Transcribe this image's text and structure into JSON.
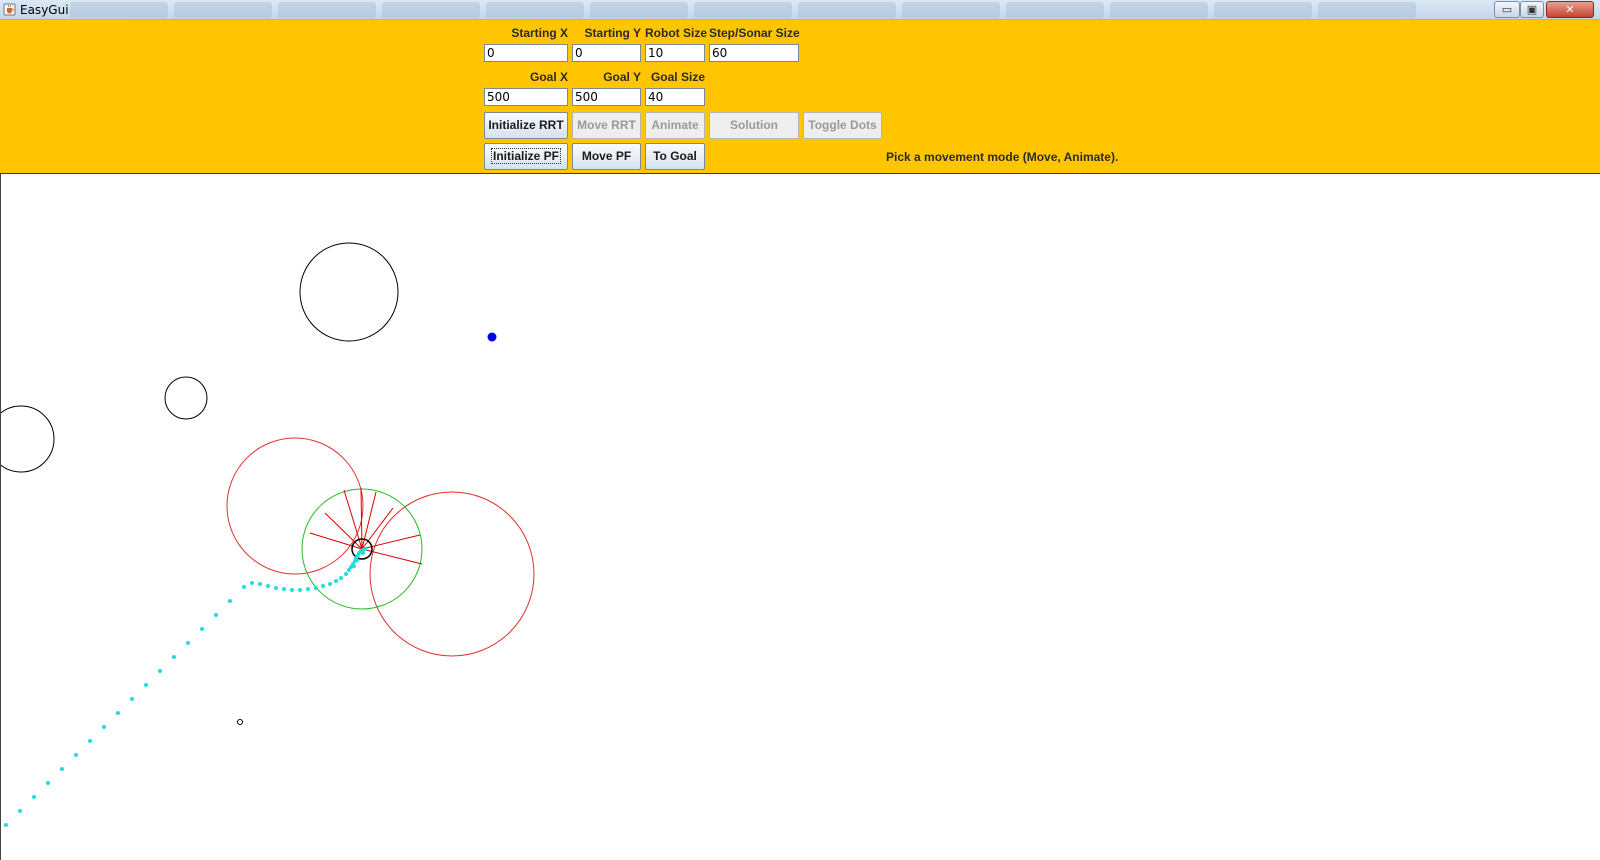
{
  "window": {
    "title": "EasyGui",
    "controls": {
      "minimize": "▭",
      "maximize": "▣",
      "close": "✕"
    }
  },
  "form": {
    "row1": [
      {
        "label": "Starting X",
        "value": "0"
      },
      {
        "label": "Starting Y",
        "value": "0"
      },
      {
        "label": "Robot Size",
        "value": "10"
      },
      {
        "label": "Step/Sonar Size",
        "value": "60"
      }
    ],
    "row2": [
      {
        "label": "Goal X",
        "value": "500"
      },
      {
        "label": "Goal Y",
        "value": "500"
      },
      {
        "label": "Goal Size",
        "value": "40"
      }
    ]
  },
  "buttons": {
    "initialize_rrt": {
      "label": "Initialize RRT",
      "enabled": true
    },
    "move_rrt": {
      "label": "Move RRT",
      "enabled": false
    },
    "animate": {
      "label": "Animate",
      "enabled": false
    },
    "solution": {
      "label": "Solution",
      "enabled": false
    },
    "toggle_dots": {
      "label": "Toggle Dots",
      "enabled": false
    },
    "initialize_pf": {
      "label": "Initialize PF",
      "enabled": true,
      "focused": true
    },
    "move_pf": {
      "label": "Move PF",
      "enabled": true
    },
    "to_goal": {
      "label": "To Goal",
      "enabled": true
    }
  },
  "status_message": "Pick a movement mode (Move, Animate).",
  "colors": {
    "panel": "#ffc600",
    "obstacle": "#000000",
    "sonar_circle": "#e03030",
    "sensor_range": "#22bb22",
    "path_dots": "#22dddd",
    "goal": "#0000ee",
    "sonar_ray": "#dd0000"
  },
  "icons": {
    "app": "java-cup-icon"
  }
}
